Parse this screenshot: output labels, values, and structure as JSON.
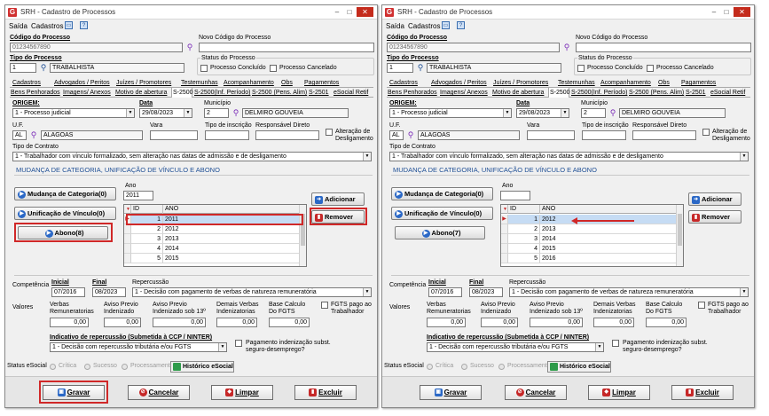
{
  "window": {
    "title": "SRH - Cadastro de Processos",
    "close_glyph": "✕",
    "minimize_glyph": "–",
    "maximize_glyph": "□"
  },
  "menu": {
    "items": [
      "Saída",
      "Cadastros"
    ],
    "icons": [
      "monitor-icon",
      "help-icon"
    ]
  },
  "processo": {
    "codigo_label": "Código do Processo",
    "codigo_value": "01234567890",
    "novo_codigo_label": "Novo Código do Processo",
    "novo_codigo_value": "",
    "tipo_label": "Tipo do Processo",
    "tipo_code": "1",
    "tipo_name": "TRABALHISTA",
    "status_label": "Status do Processo",
    "status_concluido": "Processo Concluído",
    "status_cancelado": "Processo Cancelado"
  },
  "tabs_row1": [
    "Cadastros",
    "Advogados / Peritos",
    "Juízes / Promotores",
    "Testemunhas",
    "Acompanhamento",
    "Obs",
    "Pagamentos"
  ],
  "tabs_row2_left": [
    "Bens Penhorados",
    "Imagens/ Anexos",
    "Motivo de abertura",
    "S-2500",
    "S-2500(Inf. Período)",
    "S-2500 (Pens. Alim)",
    "S-2501",
    "eSocial Retif"
  ],
  "tabs_row2_right": [
    "Bens Penhorados",
    "Imagens/ Anexos",
    "Motivo de abertura",
    "S-2500",
    "S-2500(Inf. Período)",
    "S-2500 (Pens. Alim)",
    "S-2501",
    "eSocial Retif"
  ],
  "s2500": {
    "origem_label": "ORIGEM:",
    "origem_value": "1 - Processo judicial",
    "data_label": "Data",
    "data_value": "29/08/2023",
    "municipio_label": "Município",
    "municipio_code": "2",
    "municipio_name": "DELMIRO GOUVEIA",
    "uf_label": "U.F.",
    "uf_code": "AL",
    "uf_name": "ALAGOAS",
    "vara_label": "Vara",
    "tipo_inscricao_label": "Tipo de inscrição",
    "responsavel_label": "Responsável Direto",
    "alteracao_label_1": "Alteração de",
    "alteracao_label_2": "Desligamento",
    "tipo_contrato_label": "Tipo de Contrato",
    "tipo_contrato_value": "1 - Trabalhador com vínculo formalizado, sem alteração nas datas de admissão e de desligamento"
  },
  "mudanca": {
    "section_title": "MUDANÇA DE CATEGORIA, UNIFICAÇÃO DE VÍNCULO E ABONO",
    "btn_mudanca": "Mudança de Categoria(0)",
    "btn_unificacao": "Unificação de Vínculo(0)",
    "btn_abono_left": "Abono(8)",
    "btn_abono_right": "Abono(7)",
    "ano_label": "Ano",
    "ano_value_left": "2011",
    "ano_value_right": "",
    "btn_adicionar": "Adicionar",
    "btn_remover": "Remover",
    "grid_headers": [
      "ID",
      "ANO"
    ],
    "rows_left": [
      {
        "id": "1",
        "ano": "2011"
      },
      {
        "id": "2",
        "ano": "2012"
      },
      {
        "id": "3",
        "ano": "2013"
      },
      {
        "id": "4",
        "ano": "2014"
      },
      {
        "id": "5",
        "ano": "2015"
      }
    ],
    "rows_right": [
      {
        "id": "1",
        "ano": "2012"
      },
      {
        "id": "2",
        "ano": "2013"
      },
      {
        "id": "3",
        "ano": "2014"
      },
      {
        "id": "4",
        "ano": "2015"
      },
      {
        "id": "5",
        "ano": "2016"
      }
    ]
  },
  "competencia": {
    "label": "Competência",
    "inicial_label": "Inicial",
    "inicial_value": "07/2016",
    "final_label": "Final",
    "final_value": "08/2023",
    "repercussao_label": "Repercussão",
    "repercussao_value": "1 - Decisão com pagamento de verbas de natureza remuneratória"
  },
  "valores": {
    "label": "Valores",
    "cols": [
      {
        "l1": "Verbas",
        "l2": "Remuneratorias",
        "value": "0,00"
      },
      {
        "l1": "Aviso Previo",
        "l2": "Indenizado",
        "value": "0,00"
      },
      {
        "l1": "Aviso Previo",
        "l2": "Indenizado sob 13º",
        "value": "0,00"
      },
      {
        "l1": "Demais Verbas",
        "l2": "Indenizatorias",
        "value": "0,00"
      },
      {
        "l1": "Base Calculo",
        "l2": "Do FGTS",
        "value": "0,00"
      }
    ],
    "fgts_1": "FGTS pago ao",
    "fgts_2": "Trabalhador"
  },
  "indicativo": {
    "label": "Indicativo de repercussão (Submetida à CCP / NINTER)",
    "value": "1 - Decisão com repercussão tributária e/ou FGTS",
    "pagamento_1": "Pagamento indenização subst.",
    "pagamento_2": "seguro-desemprego?"
  },
  "status": {
    "label": "Status eSocial",
    "critica": "Crítica",
    "sucesso": "Sucesso",
    "processamento": "Processamento",
    "historico_btn": "Histórico eSocial"
  },
  "footer": {
    "gravar": "Gravar",
    "cancelar": "Cancelar",
    "limpar": "Limpar",
    "excluir": "Excluir"
  },
  "colors": {
    "highlight": "#d02828",
    "selection": "#c6dcf4",
    "section": "#1f4f95",
    "button_blue": "#2b68c6"
  }
}
